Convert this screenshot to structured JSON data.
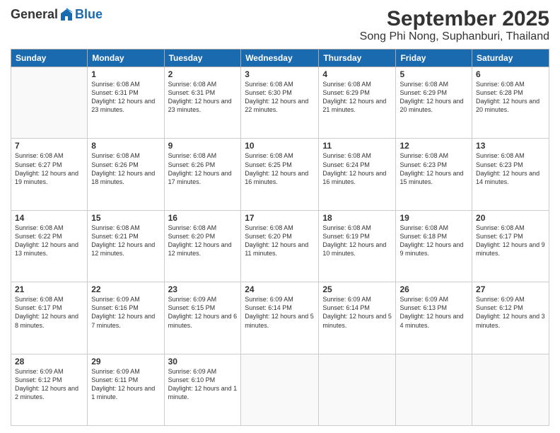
{
  "logo": {
    "general": "General",
    "blue": "Blue"
  },
  "title": "September 2025",
  "subtitle": "Song Phi Nong, Suphanburi, Thailand",
  "weekdays": [
    "Sunday",
    "Monday",
    "Tuesday",
    "Wednesday",
    "Thursday",
    "Friday",
    "Saturday"
  ],
  "weeks": [
    [
      {
        "day": "",
        "sunrise": "",
        "sunset": "",
        "daylight": ""
      },
      {
        "day": "1",
        "sunrise": "Sunrise: 6:08 AM",
        "sunset": "Sunset: 6:31 PM",
        "daylight": "Daylight: 12 hours and 23 minutes."
      },
      {
        "day": "2",
        "sunrise": "Sunrise: 6:08 AM",
        "sunset": "Sunset: 6:31 PM",
        "daylight": "Daylight: 12 hours and 23 minutes."
      },
      {
        "day": "3",
        "sunrise": "Sunrise: 6:08 AM",
        "sunset": "Sunset: 6:30 PM",
        "daylight": "Daylight: 12 hours and 22 minutes."
      },
      {
        "day": "4",
        "sunrise": "Sunrise: 6:08 AM",
        "sunset": "Sunset: 6:29 PM",
        "daylight": "Daylight: 12 hours and 21 minutes."
      },
      {
        "day": "5",
        "sunrise": "Sunrise: 6:08 AM",
        "sunset": "Sunset: 6:29 PM",
        "daylight": "Daylight: 12 hours and 20 minutes."
      },
      {
        "day": "6",
        "sunrise": "Sunrise: 6:08 AM",
        "sunset": "Sunset: 6:28 PM",
        "daylight": "Daylight: 12 hours and 20 minutes."
      }
    ],
    [
      {
        "day": "7",
        "sunrise": "Sunrise: 6:08 AM",
        "sunset": "Sunset: 6:27 PM",
        "daylight": "Daylight: 12 hours and 19 minutes."
      },
      {
        "day": "8",
        "sunrise": "Sunrise: 6:08 AM",
        "sunset": "Sunset: 6:26 PM",
        "daylight": "Daylight: 12 hours and 18 minutes."
      },
      {
        "day": "9",
        "sunrise": "Sunrise: 6:08 AM",
        "sunset": "Sunset: 6:26 PM",
        "daylight": "Daylight: 12 hours and 17 minutes."
      },
      {
        "day": "10",
        "sunrise": "Sunrise: 6:08 AM",
        "sunset": "Sunset: 6:25 PM",
        "daylight": "Daylight: 12 hours and 16 minutes."
      },
      {
        "day": "11",
        "sunrise": "Sunrise: 6:08 AM",
        "sunset": "Sunset: 6:24 PM",
        "daylight": "Daylight: 12 hours and 16 minutes."
      },
      {
        "day": "12",
        "sunrise": "Sunrise: 6:08 AM",
        "sunset": "Sunset: 6:23 PM",
        "daylight": "Daylight: 12 hours and 15 minutes."
      },
      {
        "day": "13",
        "sunrise": "Sunrise: 6:08 AM",
        "sunset": "Sunset: 6:23 PM",
        "daylight": "Daylight: 12 hours and 14 minutes."
      }
    ],
    [
      {
        "day": "14",
        "sunrise": "Sunrise: 6:08 AM",
        "sunset": "Sunset: 6:22 PM",
        "daylight": "Daylight: 12 hours and 13 minutes."
      },
      {
        "day": "15",
        "sunrise": "Sunrise: 6:08 AM",
        "sunset": "Sunset: 6:21 PM",
        "daylight": "Daylight: 12 hours and 12 minutes."
      },
      {
        "day": "16",
        "sunrise": "Sunrise: 6:08 AM",
        "sunset": "Sunset: 6:20 PM",
        "daylight": "Daylight: 12 hours and 12 minutes."
      },
      {
        "day": "17",
        "sunrise": "Sunrise: 6:08 AM",
        "sunset": "Sunset: 6:20 PM",
        "daylight": "Daylight: 12 hours and 11 minutes."
      },
      {
        "day": "18",
        "sunrise": "Sunrise: 6:08 AM",
        "sunset": "Sunset: 6:19 PM",
        "daylight": "Daylight: 12 hours and 10 minutes."
      },
      {
        "day": "19",
        "sunrise": "Sunrise: 6:08 AM",
        "sunset": "Sunset: 6:18 PM",
        "daylight": "Daylight: 12 hours and 9 minutes."
      },
      {
        "day": "20",
        "sunrise": "Sunrise: 6:08 AM",
        "sunset": "Sunset: 6:17 PM",
        "daylight": "Daylight: 12 hours and 9 minutes."
      }
    ],
    [
      {
        "day": "21",
        "sunrise": "Sunrise: 6:08 AM",
        "sunset": "Sunset: 6:17 PM",
        "daylight": "Daylight: 12 hours and 8 minutes."
      },
      {
        "day": "22",
        "sunrise": "Sunrise: 6:09 AM",
        "sunset": "Sunset: 6:16 PM",
        "daylight": "Daylight: 12 hours and 7 minutes."
      },
      {
        "day": "23",
        "sunrise": "Sunrise: 6:09 AM",
        "sunset": "Sunset: 6:15 PM",
        "daylight": "Daylight: 12 hours and 6 minutes."
      },
      {
        "day": "24",
        "sunrise": "Sunrise: 6:09 AM",
        "sunset": "Sunset: 6:14 PM",
        "daylight": "Daylight: 12 hours and 5 minutes."
      },
      {
        "day": "25",
        "sunrise": "Sunrise: 6:09 AM",
        "sunset": "Sunset: 6:14 PM",
        "daylight": "Daylight: 12 hours and 5 minutes."
      },
      {
        "day": "26",
        "sunrise": "Sunrise: 6:09 AM",
        "sunset": "Sunset: 6:13 PM",
        "daylight": "Daylight: 12 hours and 4 minutes."
      },
      {
        "day": "27",
        "sunrise": "Sunrise: 6:09 AM",
        "sunset": "Sunset: 6:12 PM",
        "daylight": "Daylight: 12 hours and 3 minutes."
      }
    ],
    [
      {
        "day": "28",
        "sunrise": "Sunrise: 6:09 AM",
        "sunset": "Sunset: 6:12 PM",
        "daylight": "Daylight: 12 hours and 2 minutes."
      },
      {
        "day": "29",
        "sunrise": "Sunrise: 6:09 AM",
        "sunset": "Sunset: 6:11 PM",
        "daylight": "Daylight: 12 hours and 1 minute."
      },
      {
        "day": "30",
        "sunrise": "Sunrise: 6:09 AM",
        "sunset": "Sunset: 6:10 PM",
        "daylight": "Daylight: 12 hours and 1 minute."
      },
      {
        "day": "",
        "sunrise": "",
        "sunset": "",
        "daylight": ""
      },
      {
        "day": "",
        "sunrise": "",
        "sunset": "",
        "daylight": ""
      },
      {
        "day": "",
        "sunrise": "",
        "sunset": "",
        "daylight": ""
      },
      {
        "day": "",
        "sunrise": "",
        "sunset": "",
        "daylight": ""
      }
    ]
  ]
}
